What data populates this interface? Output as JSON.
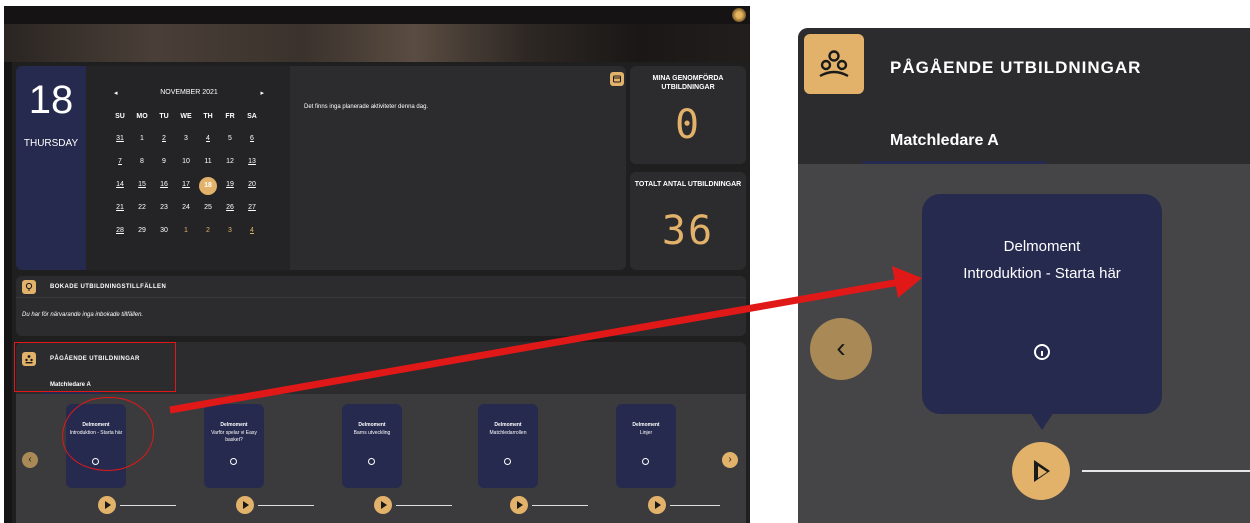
{
  "calendar": {
    "day_number": "18",
    "weekday": "THURSDAY",
    "month_label": "NOVEMBER 2021",
    "prev_arrow": "◂",
    "next_arrow": "▸",
    "weekday_headers": [
      "SU",
      "MO",
      "TU",
      "WE",
      "TH",
      "FR",
      "SA"
    ],
    "weeks": [
      [
        "31",
        "1",
        "2",
        "3",
        "4",
        "5",
        "6"
      ],
      [
        "7",
        "8",
        "9",
        "10",
        "11",
        "12",
        "13"
      ],
      [
        "14",
        "15",
        "16",
        "17",
        "18",
        "19",
        "20"
      ],
      [
        "21",
        "22",
        "23",
        "24",
        "25",
        "26",
        "27"
      ],
      [
        "28",
        "29",
        "30",
        "1",
        "2",
        "3",
        "4"
      ]
    ],
    "selected_day": "18",
    "no_activities_text": "Det finns inga planerade aktiviteter denna dag."
  },
  "counters": {
    "completed_label": "MINA GENOMFÖRDA UTBILDNINGAR",
    "completed_value": "0",
    "total_label": "TOTALT ANTAL UTBILDNINGAR",
    "total_value": "36"
  },
  "booked": {
    "title": "BOKADE UTBILDNINGSTILLFÄLLEN",
    "message": "Du har för närvarande inga inbokade tillfällen."
  },
  "ongoing": {
    "title": "PÅGÅENDE UTBILDNINGAR",
    "tab": "Matchledare A",
    "modules": [
      {
        "kicker": "Delmoment",
        "title": "Introduktion - Starta här"
      },
      {
        "kicker": "Delmoment",
        "title": "Varför spelar vi Easy basket?"
      },
      {
        "kicker": "Delmoment",
        "title": "Barns utveckling"
      },
      {
        "kicker": "Delmoment",
        "title": "Matchledarrollen"
      },
      {
        "kicker": "Delmoment",
        "title": "Linjer"
      }
    ],
    "prev_button": "‹",
    "next_button": "›"
  },
  "zoom": {
    "title": "PÅGÅENDE UTBILDNINGAR",
    "tab": "Matchledare A",
    "card_kicker": "Delmoment",
    "card_title": "Introduktion - Starta här",
    "back_button": "‹"
  },
  "colors": {
    "accent": "#e2b26a",
    "navy": "#262a4e",
    "panel": "#2c2c2e",
    "annotation": "#e01818"
  },
  "icons": {
    "calendar": "calendar-icon",
    "location": "location-pin-icon",
    "ongoing": "people-group-icon",
    "play": "play-icon",
    "info": "info-icon"
  }
}
